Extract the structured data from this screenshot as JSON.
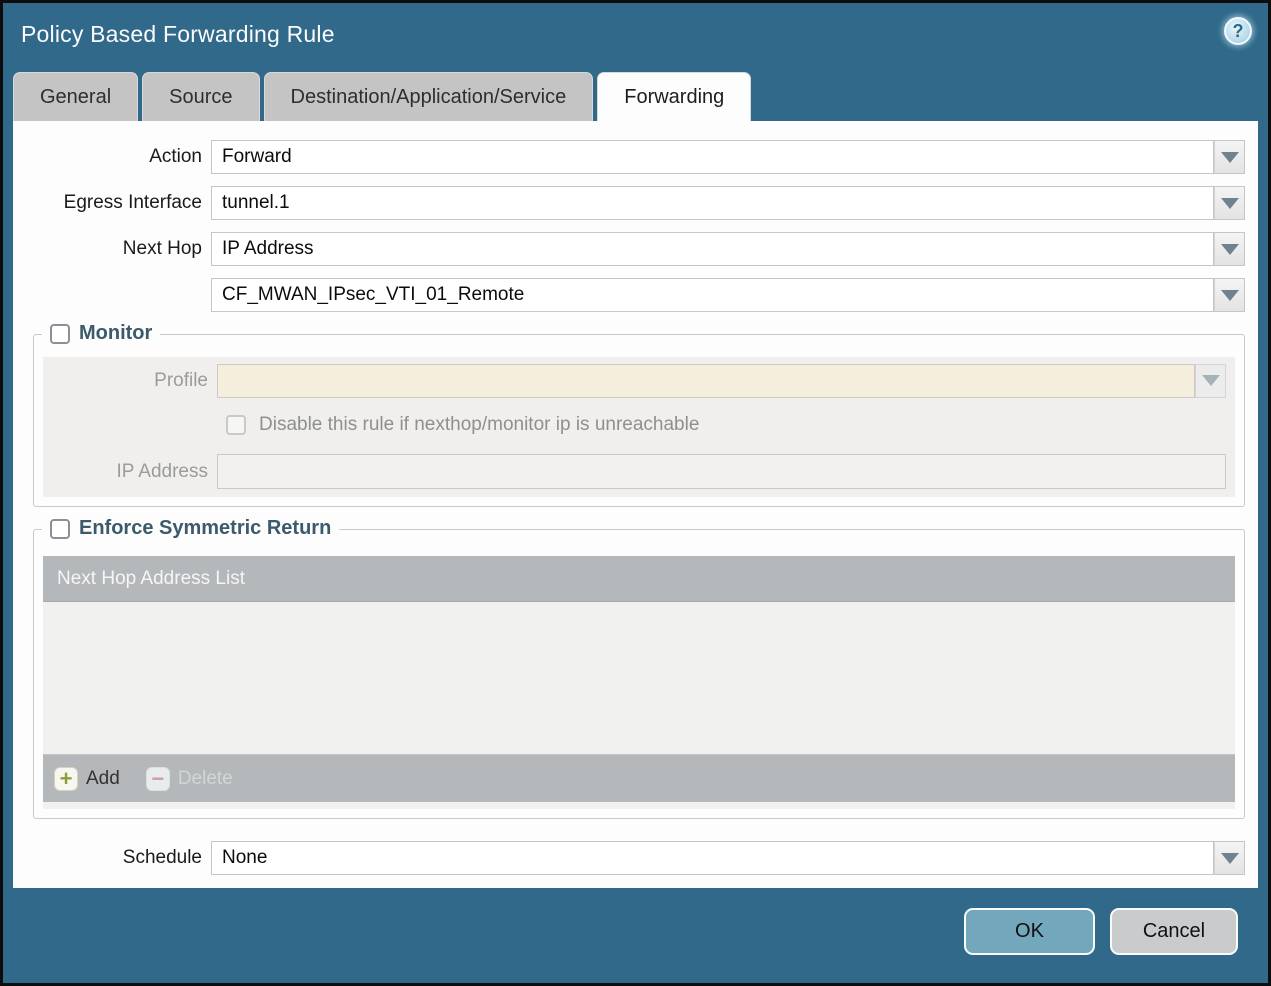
{
  "window": {
    "title": "Policy Based Forwarding Rule"
  },
  "icons": {
    "help_glyph": "?",
    "add_glyph": "+",
    "delete_glyph": "−"
  },
  "tabs": [
    {
      "label": "General",
      "active": false
    },
    {
      "label": "Source",
      "active": false
    },
    {
      "label": "Destination/Application/Service",
      "active": false
    },
    {
      "label": "Forwarding",
      "active": true
    }
  ],
  "form": {
    "action": {
      "label": "Action",
      "value": "Forward"
    },
    "egress_interface": {
      "label": "Egress Interface",
      "value": "tunnel.1"
    },
    "next_hop": {
      "label": "Next Hop",
      "value": "IP Address"
    },
    "next_hop_address": {
      "value": "CF_MWAN_IPsec_VTI_01_Remote"
    },
    "schedule": {
      "label": "Schedule",
      "value": "None"
    }
  },
  "monitor": {
    "legend": "Monitor",
    "checked": false,
    "profile": {
      "label": "Profile",
      "value": ""
    },
    "disable_rule_label": "Disable this rule if nexthop/monitor ip is unreachable",
    "disable_rule_checked": false,
    "ip_address": {
      "label": "IP Address",
      "value": ""
    }
  },
  "symmetric_return": {
    "legend": "Enforce Symmetric Return",
    "checked": false,
    "table_header": "Next Hop Address List",
    "rows": [],
    "add_label": "Add",
    "delete_label": "Delete",
    "delete_enabled": false
  },
  "footer": {
    "ok_label": "OK",
    "cancel_label": "Cancel"
  },
  "colors": {
    "titlebar_teal": "#30698a",
    "active_tab": "#fdfdfd",
    "inactive_tab": "#c4c4c4",
    "disabled_field_cream": "#f5eedd",
    "table_gray": "#b4b8ba",
    "ok_button": "#73a7bc",
    "cancel_button": "#c9cbcd",
    "legend_text": "#3c5a6c",
    "add_plus": "#8e9c3a",
    "delete_minus": "#cf9aa1"
  }
}
